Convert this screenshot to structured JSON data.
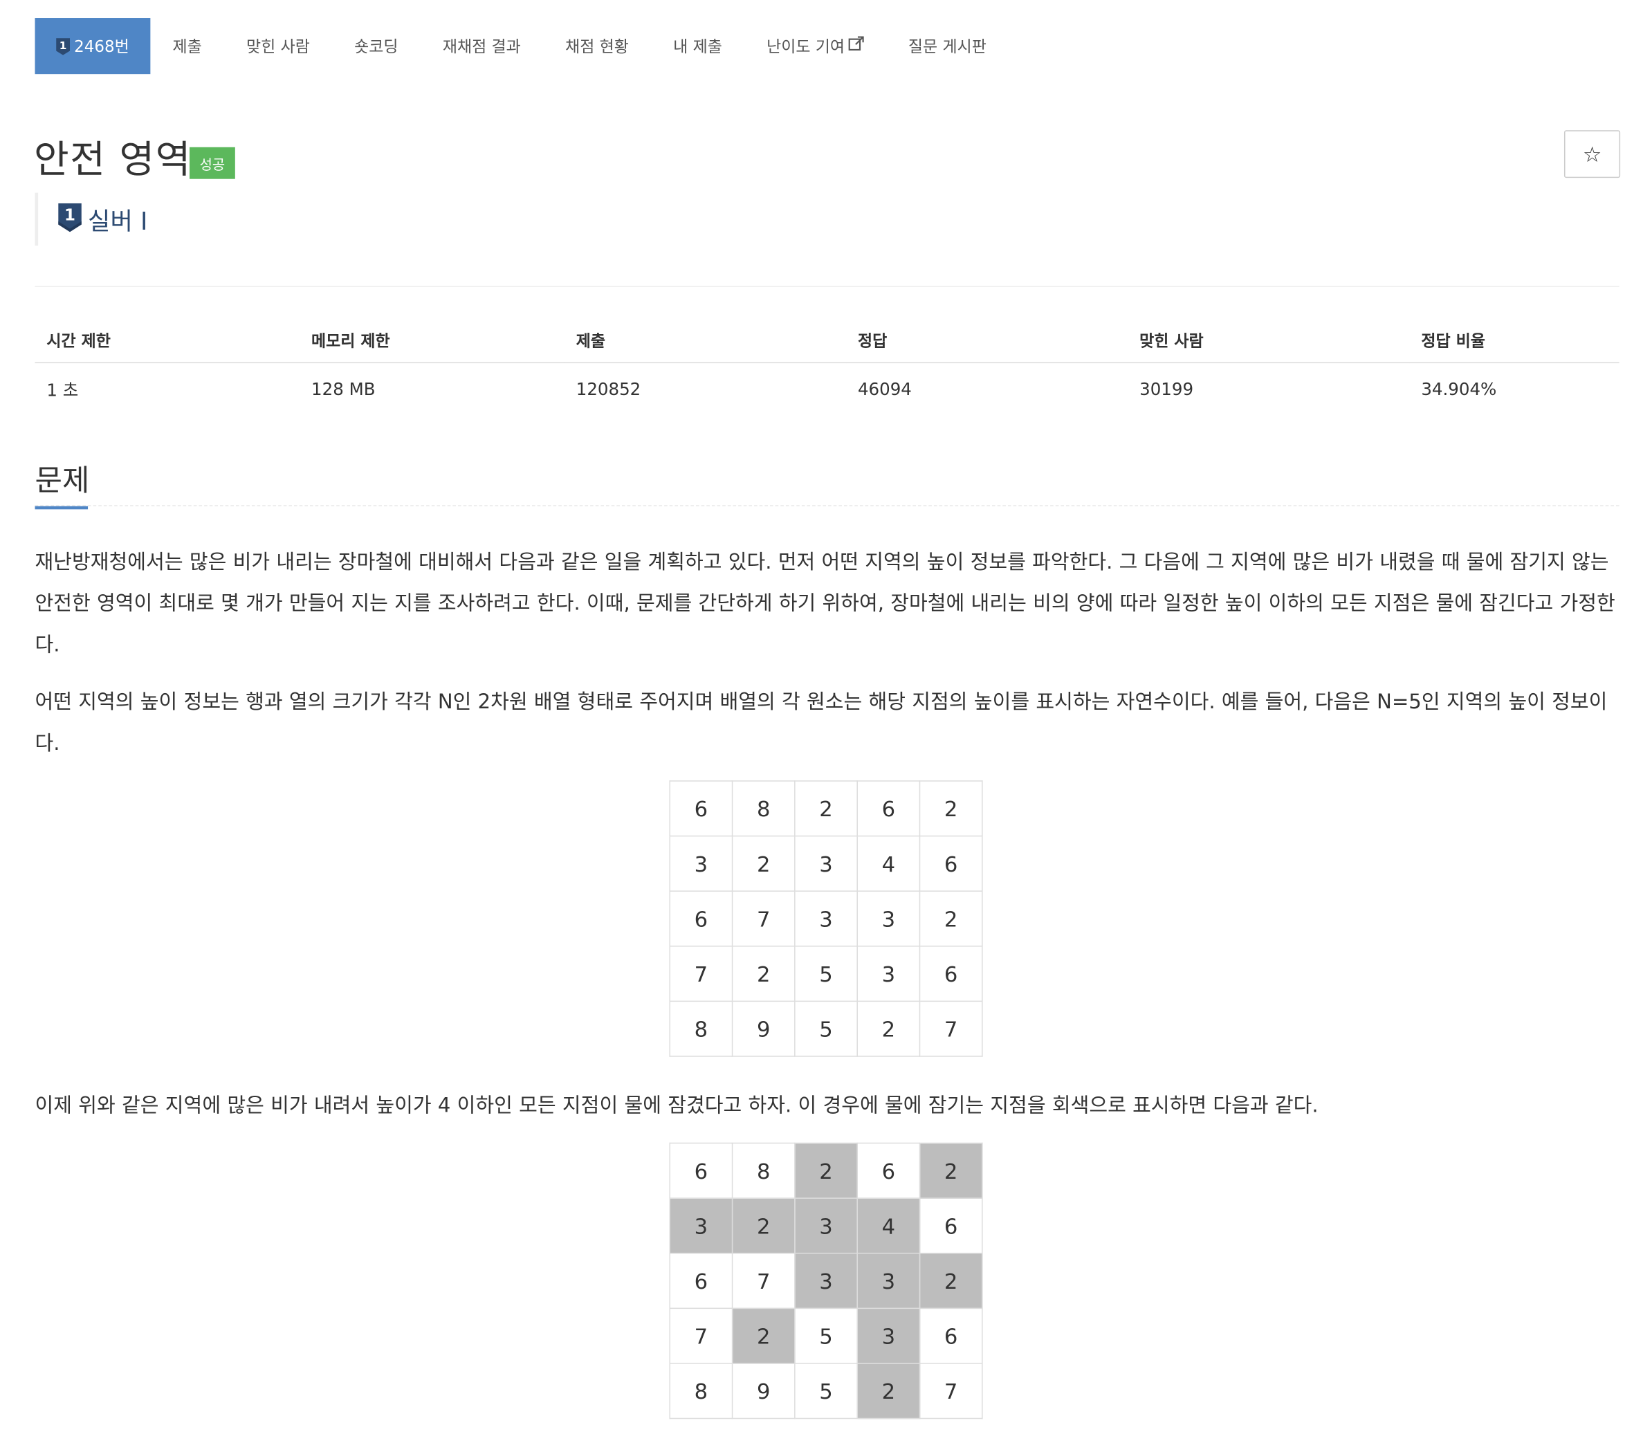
{
  "nav": {
    "items": [
      {
        "label": "2468번",
        "active": true
      },
      {
        "label": "제출"
      },
      {
        "label": "맞힌 사람"
      },
      {
        "label": "숏코딩"
      },
      {
        "label": "재채점 결과"
      },
      {
        "label": "채점 현황"
      },
      {
        "label": "내 제출"
      },
      {
        "label": "난이도 기여",
        "external": true
      },
      {
        "label": "질문 게시판"
      }
    ]
  },
  "problem": {
    "title": "안전 영역",
    "status_badge": "성공",
    "star": "☆",
    "tier_num": "1",
    "tier_label": "실버 I"
  },
  "info": {
    "headers": [
      "시간 제한",
      "메모리 제한",
      "제출",
      "정답",
      "맞힌 사람",
      "정답 비율"
    ],
    "values": [
      "1 초",
      "128 MB",
      "120852",
      "46094",
      "30199",
      "34.904%"
    ]
  },
  "section": {
    "title": "문제",
    "p1": "재난방재청에서는 많은 비가 내리는 장마철에 대비해서 다음과 같은 일을 계획하고 있다. 먼저 어떤 지역의 높이 정보를 파악한다. 그 다음에 그 지역에 많은 비가 내렸을 때 물에 잠기지 않는 안전한 영역이 최대로 몇 개가 만들어 지는 지를 조사하려고 한다. 이때, 문제를 간단하게 하기 위하여, 장마철에 내리는 비의 양에 따라 일정한 높이 이하의 모든 지점은 물에 잠긴다고 가정한다.",
    "p2": "어떤 지역의 높이 정보는 행과 열의 크기가 각각 N인 2차원 배열 형태로 주어지며 배열의 각 원소는 해당 지점의 높이를 표시하는 자연수이다. 예를 들어, 다음은 N=5인 지역의 높이 정보이다.",
    "p3": "이제 위와 같은 지역에 많은 비가 내려서 높이가 4 이하인 모든 지점이 물에 잠겼다고 하자. 이 경우에 물에 잠기는 지점을 회색으로 표시하면 다음과 같다."
  },
  "grid": [
    [
      "6",
      "8",
      "2",
      "6",
      "2"
    ],
    [
      "3",
      "2",
      "3",
      "4",
      "6"
    ],
    [
      "6",
      "7",
      "3",
      "3",
      "2"
    ],
    [
      "7",
      "2",
      "5",
      "3",
      "6"
    ],
    [
      "8",
      "9",
      "5",
      "2",
      "7"
    ]
  ],
  "flood_level": 4,
  "colors": {
    "active_tab": "#4f86c6",
    "success": "#5cb85c",
    "flooded": "#bdbdbd",
    "tier": "#2c4a72"
  }
}
